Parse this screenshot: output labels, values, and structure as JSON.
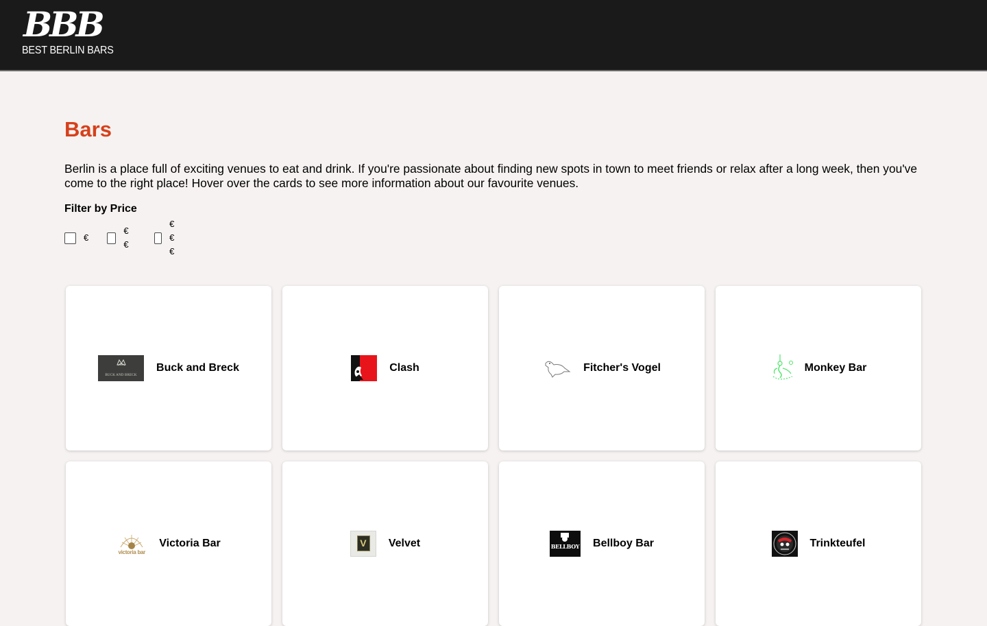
{
  "header": {
    "logo_mark": "BBB",
    "logo_text": "BEST BERLIN BARS"
  },
  "main": {
    "title": "Bars",
    "intro": "Berlin is a place full of exciting venues to eat and drink. If you're passionate about finding new spots in town to meet friends or relax after a long week, then you've come to the right place! Hover over the cards to see more information about our favourite venues.",
    "filter_title": "Filter by Price",
    "filters": [
      {
        "label": "€",
        "checked": false
      },
      {
        "label": "€€",
        "checked": false
      },
      {
        "label": "€€€",
        "checked": false
      }
    ]
  },
  "cards": [
    {
      "name": "Buck and Breck",
      "logo": "buck-and-breck-logo",
      "logo_text": "BUCK AND BRECK"
    },
    {
      "name": "Clash",
      "logo": "clash-logo"
    },
    {
      "name": "Fitcher's Vogel",
      "logo": "bird-logo"
    },
    {
      "name": "Monkey Bar",
      "logo": "monkey-logo"
    },
    {
      "name": "Victoria Bar",
      "logo": "victoria-bar-logo",
      "logo_text": "victoria bar"
    },
    {
      "name": "Velvet",
      "logo": "velvet-logo",
      "logo_text": "V"
    },
    {
      "name": "Bellboy Bar",
      "logo": "bellboy-logo",
      "logo_text": "BELLBOY"
    },
    {
      "name": "Trinkteufel",
      "logo": "trinkteufel-logo"
    }
  ],
  "colors": {
    "header_bg": "#1b1a1a",
    "page_bg": "#f6f2f1",
    "accent": "#d6401b",
    "card_bg": "#ffffff",
    "monkey_green": "#4fe36a"
  }
}
